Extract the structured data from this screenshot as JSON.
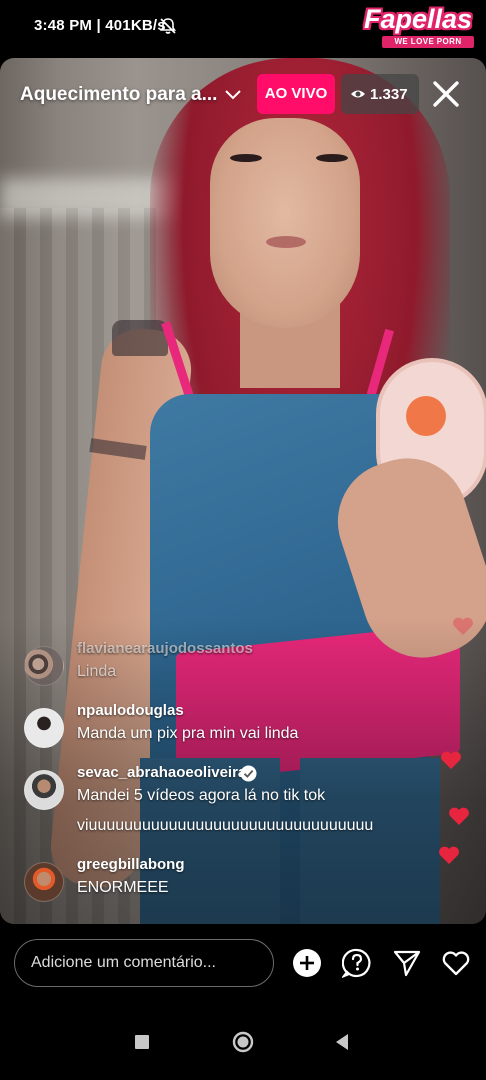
{
  "status_bar": {
    "time_speed": "3:48 PM | 401KB/s",
    "icon": "notifications-off-icon"
  },
  "watermark": {
    "name": "Fapellas",
    "tagline": "WE LOVE PORN",
    "color": "#e0246a"
  },
  "live": {
    "title": "Aquecimento para a...",
    "badge": "AO VIVO",
    "badge_color": "#ff0d68",
    "viewers": "1.337"
  },
  "comments": [
    {
      "user": "flavianearaujodossantos",
      "text": "Linda",
      "verified": false
    },
    {
      "user": "npaulodouglas",
      "text": "Manda um pix pra min  vai linda",
      "verified": false
    },
    {
      "user": "sevac_abrahaoeoliveira",
      "text": "Mandei 5 vídeos agora lá no tik tok",
      "text_line2": "viuuuuuuuuuuuuuuuuuuuuuuuuuuuuuuuu",
      "verified": true
    },
    {
      "user": "greegbillabong",
      "text": "ENORMEEE",
      "verified": false
    }
  ],
  "comment_bar": {
    "placeholder": "Adicione um comentário...",
    "icons": [
      "add-icon",
      "question-icon",
      "send-icon",
      "like-heart-icon"
    ]
  },
  "nav": {
    "icons": [
      "recents-icon",
      "home-icon",
      "back-icon"
    ]
  }
}
